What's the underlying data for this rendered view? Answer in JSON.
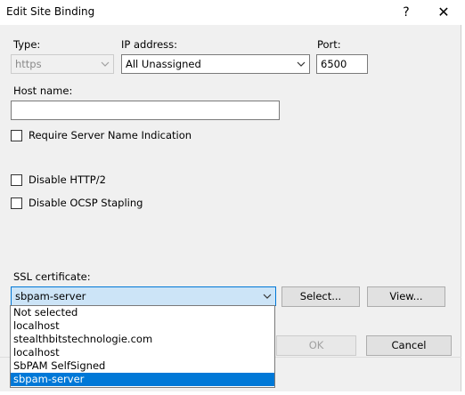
{
  "window": {
    "title": "Edit Site Binding",
    "help_label": "?",
    "close_label": "✕"
  },
  "type": {
    "label": "Type:",
    "value": "https"
  },
  "ip": {
    "label": "IP address:",
    "value": "All Unassigned"
  },
  "port": {
    "label": "Port:",
    "value": "6500"
  },
  "host": {
    "label": "Host name:",
    "value": ""
  },
  "checks": {
    "sni": "Require Server Name Indication",
    "http2": "Disable HTTP/2",
    "ocsp": "Disable OCSP Stapling"
  },
  "ssl": {
    "label": "SSL certificate:",
    "value": "sbpam-server",
    "select_label": "Select...",
    "view_label": "View...",
    "options": [
      "Not selected",
      "localhost",
      "stealthbitstechnologie.com",
      "localhost",
      "SbPAM SelfSigned",
      "sbpam-server"
    ],
    "selected_index": 5
  },
  "footer": {
    "ok_label": "OK",
    "cancel_label": "Cancel"
  }
}
